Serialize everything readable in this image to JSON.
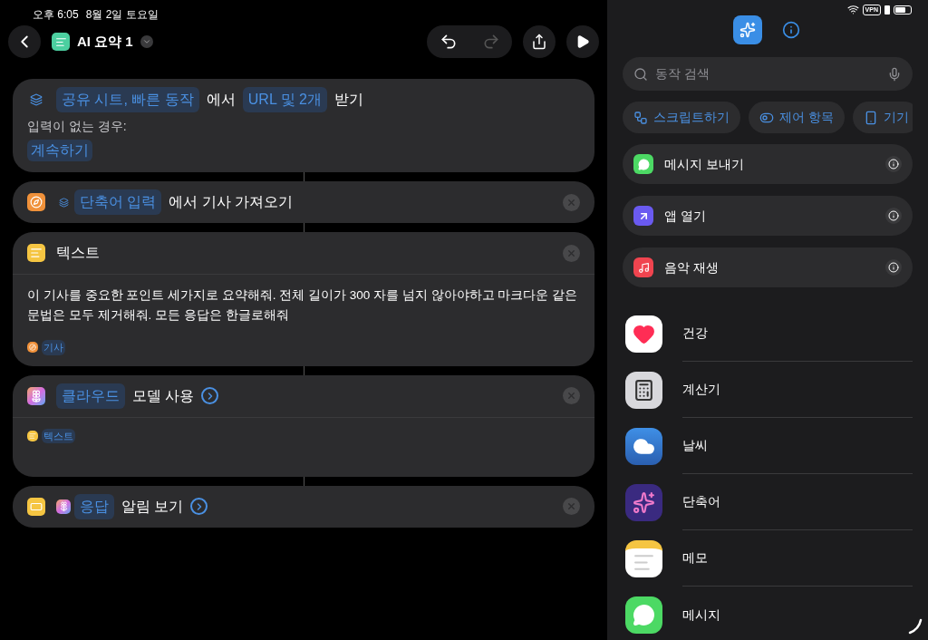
{
  "status_bar": {
    "time": "오후 6:05",
    "date": "8월 2일 토요일",
    "vpn": "VPN"
  },
  "header": {
    "title": "AI 요약 1",
    "undo_enabled": true,
    "redo_enabled": false
  },
  "actions": [
    {
      "kind": "receive",
      "parts": [
        {
          "kind": "token",
          "text": "공유 시트, 빠른 동작"
        },
        {
          "kind": "plain",
          "text": "에서"
        },
        {
          "kind": "token",
          "text": "URL 및 2개"
        },
        {
          "kind": "plain",
          "text": "받기"
        }
      ],
      "removable": false,
      "has_more": false,
      "fallback_label": "입력이 없는 경우:",
      "fallback_value": "계속하기"
    },
    {
      "kind": "safari",
      "parts": [
        {
          "kind": "input-token",
          "text": "단축어 입력"
        },
        {
          "kind": "plain",
          "text": "에서 기사 가져오기"
        }
      ],
      "removable": true,
      "has_more": false
    },
    {
      "kind": "text",
      "parts": [
        {
          "kind": "plain",
          "text": "텍스트"
        }
      ],
      "removable": true,
      "has_more": false,
      "body": "이 기사를 중요한 포인트 세가지로 요약해줘. 전체 길이가 300 자를 넘지 않아야하고 마크다운 같은 문법은 모두 제거해줘. 모든 응답은 한글로해줘",
      "variable": {
        "kind": "safari",
        "text": "기사"
      }
    },
    {
      "kind": "ai",
      "parts": [
        {
          "kind": "token",
          "text": "클라우드"
        },
        {
          "kind": "plain",
          "text": "모델 사용"
        }
      ],
      "removable": true,
      "has_more": true,
      "variable": {
        "kind": "text",
        "text": "텍스트"
      }
    },
    {
      "kind": "notification",
      "parts": [
        {
          "kind": "result-token",
          "text": "응답"
        },
        {
          "kind": "plain",
          "text": "알림 보기"
        }
      ],
      "removable": true,
      "has_more": true
    }
  ],
  "panel_tabs": [
    {
      "kind": "library",
      "selected": true
    },
    {
      "kind": "info",
      "selected": false
    }
  ],
  "search": {
    "placeholder": "동작 검색"
  },
  "categories": [
    {
      "kind": "scripting",
      "text": "스크립트하기"
    },
    {
      "kind": "controls",
      "text": "제어 항목"
    },
    {
      "kind": "device",
      "text": "기기"
    }
  ],
  "suggestions": [
    {
      "kind": "messages",
      "text": "메시지 보내기"
    },
    {
      "kind": "open-app",
      "text": "앱 열기"
    },
    {
      "kind": "music",
      "text": "음악 재생"
    }
  ],
  "apps": [
    {
      "kind": "health",
      "text": "건강"
    },
    {
      "kind": "calculator",
      "text": "계산기"
    },
    {
      "kind": "weather",
      "text": "날씨"
    },
    {
      "kind": "shortcuts",
      "text": "단축어"
    },
    {
      "kind": "notes",
      "text": "메모"
    },
    {
      "kind": "messages",
      "text": "메시지"
    }
  ]
}
